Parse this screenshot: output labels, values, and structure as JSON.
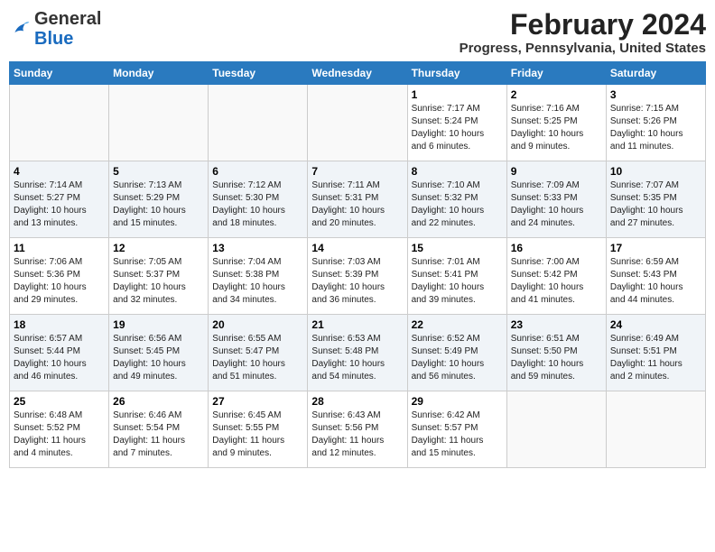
{
  "logo": {
    "general": "General",
    "blue": "Blue"
  },
  "title": "February 2024",
  "subtitle": "Progress, Pennsylvania, United States",
  "header_days": [
    "Sunday",
    "Monday",
    "Tuesday",
    "Wednesday",
    "Thursday",
    "Friday",
    "Saturday"
  ],
  "weeks": [
    [
      {
        "day": "",
        "info": ""
      },
      {
        "day": "",
        "info": ""
      },
      {
        "day": "",
        "info": ""
      },
      {
        "day": "",
        "info": ""
      },
      {
        "day": "1",
        "info": "Sunrise: 7:17 AM\nSunset: 5:24 PM\nDaylight: 10 hours\nand 6 minutes."
      },
      {
        "day": "2",
        "info": "Sunrise: 7:16 AM\nSunset: 5:25 PM\nDaylight: 10 hours\nand 9 minutes."
      },
      {
        "day": "3",
        "info": "Sunrise: 7:15 AM\nSunset: 5:26 PM\nDaylight: 10 hours\nand 11 minutes."
      }
    ],
    [
      {
        "day": "4",
        "info": "Sunrise: 7:14 AM\nSunset: 5:27 PM\nDaylight: 10 hours\nand 13 minutes."
      },
      {
        "day": "5",
        "info": "Sunrise: 7:13 AM\nSunset: 5:29 PM\nDaylight: 10 hours\nand 15 minutes."
      },
      {
        "day": "6",
        "info": "Sunrise: 7:12 AM\nSunset: 5:30 PM\nDaylight: 10 hours\nand 18 minutes."
      },
      {
        "day": "7",
        "info": "Sunrise: 7:11 AM\nSunset: 5:31 PM\nDaylight: 10 hours\nand 20 minutes."
      },
      {
        "day": "8",
        "info": "Sunrise: 7:10 AM\nSunset: 5:32 PM\nDaylight: 10 hours\nand 22 minutes."
      },
      {
        "day": "9",
        "info": "Sunrise: 7:09 AM\nSunset: 5:33 PM\nDaylight: 10 hours\nand 24 minutes."
      },
      {
        "day": "10",
        "info": "Sunrise: 7:07 AM\nSunset: 5:35 PM\nDaylight: 10 hours\nand 27 minutes."
      }
    ],
    [
      {
        "day": "11",
        "info": "Sunrise: 7:06 AM\nSunset: 5:36 PM\nDaylight: 10 hours\nand 29 minutes."
      },
      {
        "day": "12",
        "info": "Sunrise: 7:05 AM\nSunset: 5:37 PM\nDaylight: 10 hours\nand 32 minutes."
      },
      {
        "day": "13",
        "info": "Sunrise: 7:04 AM\nSunset: 5:38 PM\nDaylight: 10 hours\nand 34 minutes."
      },
      {
        "day": "14",
        "info": "Sunrise: 7:03 AM\nSunset: 5:39 PM\nDaylight: 10 hours\nand 36 minutes."
      },
      {
        "day": "15",
        "info": "Sunrise: 7:01 AM\nSunset: 5:41 PM\nDaylight: 10 hours\nand 39 minutes."
      },
      {
        "day": "16",
        "info": "Sunrise: 7:00 AM\nSunset: 5:42 PM\nDaylight: 10 hours\nand 41 minutes."
      },
      {
        "day": "17",
        "info": "Sunrise: 6:59 AM\nSunset: 5:43 PM\nDaylight: 10 hours\nand 44 minutes."
      }
    ],
    [
      {
        "day": "18",
        "info": "Sunrise: 6:57 AM\nSunset: 5:44 PM\nDaylight: 10 hours\nand 46 minutes."
      },
      {
        "day": "19",
        "info": "Sunrise: 6:56 AM\nSunset: 5:45 PM\nDaylight: 10 hours\nand 49 minutes."
      },
      {
        "day": "20",
        "info": "Sunrise: 6:55 AM\nSunset: 5:47 PM\nDaylight: 10 hours\nand 51 minutes."
      },
      {
        "day": "21",
        "info": "Sunrise: 6:53 AM\nSunset: 5:48 PM\nDaylight: 10 hours\nand 54 minutes."
      },
      {
        "day": "22",
        "info": "Sunrise: 6:52 AM\nSunset: 5:49 PM\nDaylight: 10 hours\nand 56 minutes."
      },
      {
        "day": "23",
        "info": "Sunrise: 6:51 AM\nSunset: 5:50 PM\nDaylight: 10 hours\nand 59 minutes."
      },
      {
        "day": "24",
        "info": "Sunrise: 6:49 AM\nSunset: 5:51 PM\nDaylight: 11 hours\nand 2 minutes."
      }
    ],
    [
      {
        "day": "25",
        "info": "Sunrise: 6:48 AM\nSunset: 5:52 PM\nDaylight: 11 hours\nand 4 minutes."
      },
      {
        "day": "26",
        "info": "Sunrise: 6:46 AM\nSunset: 5:54 PM\nDaylight: 11 hours\nand 7 minutes."
      },
      {
        "day": "27",
        "info": "Sunrise: 6:45 AM\nSunset: 5:55 PM\nDaylight: 11 hours\nand 9 minutes."
      },
      {
        "day": "28",
        "info": "Sunrise: 6:43 AM\nSunset: 5:56 PM\nDaylight: 11 hours\nand 12 minutes."
      },
      {
        "day": "29",
        "info": "Sunrise: 6:42 AM\nSunset: 5:57 PM\nDaylight: 11 hours\nand 15 minutes."
      },
      {
        "day": "",
        "info": ""
      },
      {
        "day": "",
        "info": ""
      }
    ]
  ]
}
